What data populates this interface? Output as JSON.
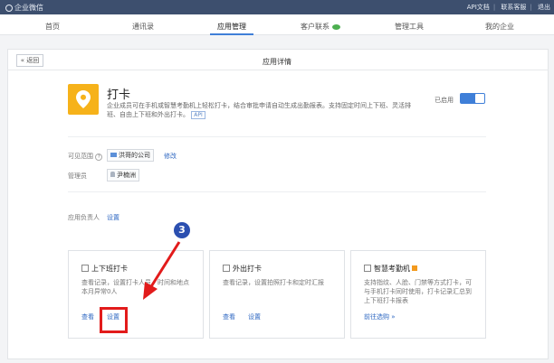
{
  "app_title": "企业微信",
  "top_links": [
    "API文档",
    "联系客服",
    "退出"
  ],
  "nav": [
    {
      "label": "首页",
      "active": false
    },
    {
      "label": "通讯录",
      "active": false
    },
    {
      "label": "应用管理",
      "active": true
    },
    {
      "label": "客户联系",
      "active": false
    },
    {
      "label": "管理工具",
      "active": false
    },
    {
      "label": "我的企业",
      "active": false
    }
  ],
  "header": {
    "back_label": "« 返回",
    "title": "应用详情"
  },
  "app": {
    "name": "打卡",
    "description": "企业成员可在手机或智慧考勤机上轻松打卡，结合审批申请自动生成出勤报表。支持固定时间上下班、灵活排班、自由上下班和外出打卡。",
    "tag": "API",
    "status_label": "已启用",
    "enabled": true
  },
  "visible_range": {
    "label": "可见范围",
    "org": "洪哥的公司",
    "edit": "修改"
  },
  "admin": {
    "label": "管理员",
    "name": "尹楠洲"
  },
  "owner": {
    "label": "应用负责人",
    "action": "设置"
  },
  "cards": [
    {
      "title": "上下班打卡",
      "desc": "查看记录，设置打卡人员、时间和地点",
      "extra": "本月异常0人",
      "links": [
        "查看",
        "设置"
      ]
    },
    {
      "title": "外出打卡",
      "desc": "查看记录，设置拍照打卡和定时汇报",
      "extra": "",
      "links": [
        "查看",
        "设置"
      ]
    },
    {
      "title": "智慧考勤机",
      "desc": "支持指纹、人脸、门禁等方式打卡，可与手机打卡同时使用，打卡记录汇总到上下班打卡报表",
      "extra": "",
      "links": [
        "前往选购 »"
      ]
    }
  ],
  "annotation": {
    "step": "3"
  },
  "colors": {
    "topbar": "#3d4f6e",
    "accent": "#3f7fd8",
    "app_icon": "#f6b21a",
    "highlight": "#e21b1b"
  }
}
